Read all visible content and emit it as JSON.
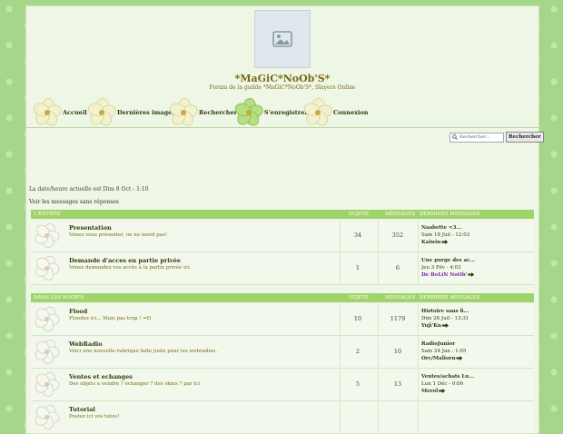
{
  "site": {
    "title": "*MaGiC*NoOb'S*",
    "description": "Forum de la guilde *MaGiC*NoOb'S*, Slayers Online"
  },
  "nav": {
    "items": [
      {
        "label": "Accueil"
      },
      {
        "label": "Dernières images"
      },
      {
        "label": "Rechercher"
      },
      {
        "label": "S'enregistrer"
      },
      {
        "label": "Connexion"
      }
    ]
  },
  "search": {
    "placeholder": "Rechercher...",
    "button_label": "Rechercher"
  },
  "status": {
    "datetime": "La date/heure actuelle est Dim 8 Oct - 1:10",
    "unanswered_link": "Voir les messages sans réponses"
  },
  "columns": {
    "topics": "SUJETS",
    "messages": "MESSAGES",
    "last": "DERNIERS MESSAGES"
  },
  "categories": [
    {
      "name": "L'ENTRÉE",
      "forums": [
        {
          "title": "Presentation",
          "desc": "Venez vous présenter, on ne mord pas!",
          "topics": "34",
          "messages": "352",
          "last_title": "Naabette <3...",
          "last_date": "Sam 18 Juil - 12:03",
          "last_author": "Kaiwin"
        },
        {
          "title": "Demande d'acces en partie privée",
          "desc": "Venez demandez vos accès à la partie privée ici.",
          "topics": "1",
          "messages": "6",
          "last_title": "Une purge des ac...",
          "last_date": "Jeu 3 Fév - 4:03",
          "last_author": "De BeLiN NoOb'"
        }
      ]
    },
    {
      "name": "DANS LES NOOB'S",
      "forums": [
        {
          "title": "Flood",
          "desc": "Floodez ici... Mais pas trop ! =D",
          "topics": "10",
          "messages": "1179",
          "last_title": "Histoire sans fi...",
          "last_date": "Dim 26 Juil - 13:31",
          "last_author": "Yuji'Kn"
        },
        {
          "title": "WebRadio",
          "desc": "Voici une nouvelle rubrique faite juste pour les webradios.",
          "topics": "2",
          "messages": "10",
          "last_title": "RadioJunior",
          "last_date": "Sam 24 Jan - 1:05",
          "last_author": "Orc/Maliorn"
        },
        {
          "title": "Ventes et echanges",
          "desc": "Des objets a vendre ? echanger ? des skins ? par ici",
          "topics": "5",
          "messages": "13",
          "last_title": "Ventes/achats Lu...",
          "last_date": "Lun 1 Déc - 0:06",
          "last_author": "Merol"
        },
        {
          "title": "Tutorial",
          "desc": "Postez ici vos tutos!",
          "topics": "",
          "messages": "",
          "last_title": "",
          "last_date": "",
          "last_author": ""
        }
      ]
    }
  ]
}
